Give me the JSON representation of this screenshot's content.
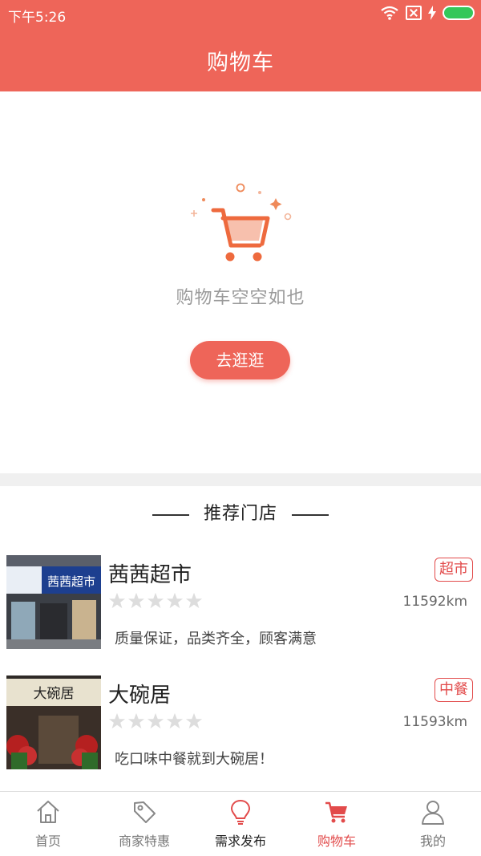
{
  "status_bar": {
    "time": "下午5:26"
  },
  "header": {
    "title": "购物车"
  },
  "empty_cart": {
    "message": "购物车空空如也",
    "button_label": "去逛逛"
  },
  "recommend": {
    "title": "推荐门店",
    "stores": [
      {
        "name": "茜茜超市",
        "tag": "超市",
        "distance": "11592km",
        "description": "质量保证，品类齐全，顾客满意",
        "rating": 0,
        "sign_text": "茜茜超市"
      },
      {
        "name": "大碗居",
        "tag": "中餐",
        "distance": "11593km",
        "description": "吃口味中餐就到大碗居！",
        "rating": 0,
        "sign_text": "大碗居"
      }
    ]
  },
  "tabbar": {
    "items": [
      {
        "label": "首页",
        "icon": "home-icon"
      },
      {
        "label": "商家特惠",
        "icon": "tag-icon"
      },
      {
        "label": "需求发布",
        "icon": "lightbulb-icon"
      },
      {
        "label": "购物车",
        "icon": "cart-icon"
      },
      {
        "label": "我的",
        "icon": "user-icon"
      }
    ],
    "active_index": 3
  },
  "colors": {
    "brand": "#ee6559",
    "tag": "#e24b4b",
    "star_empty": "#dddddd"
  }
}
